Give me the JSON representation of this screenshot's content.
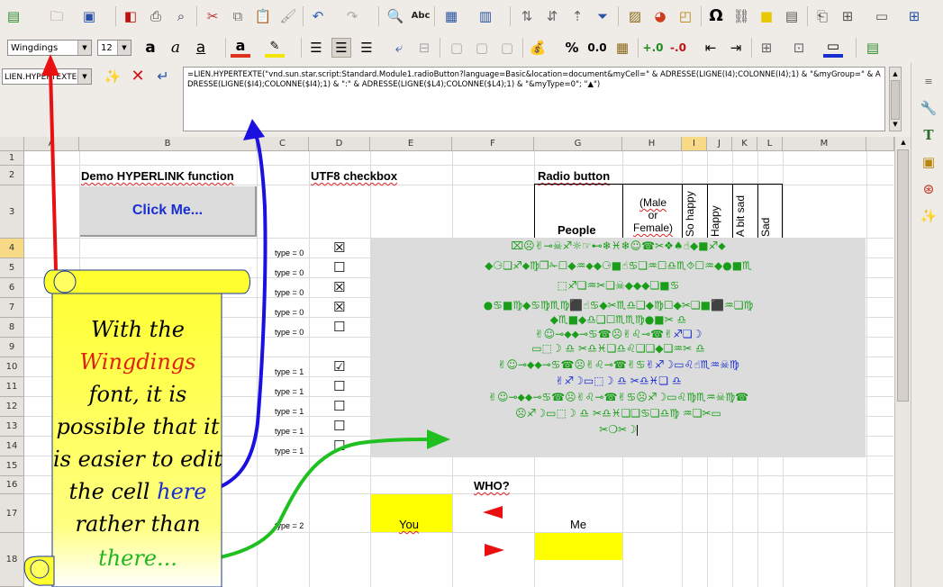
{
  "toolbar1": {
    "icons": [
      "new-document-icon",
      "open-icon",
      "save-icon",
      "pdf-export-icon",
      "print-icon",
      "print-preview-icon",
      "cut-icon",
      "copy-icon",
      "paste-icon",
      "clone-format-icon",
      "undo-icon",
      "redo-icon",
      "find-icon",
      "spellcheck-icon",
      "table-rows-icon",
      "table-columns-icon",
      "sort-ascending-icon",
      "sort-descending-icon",
      "sort-icon",
      "autofilter-icon",
      "image-icon",
      "chart-icon",
      "pivot-icon",
      "special-character-icon",
      "hyperlink-icon",
      "note-icon",
      "header-footer-icon",
      "define-print-area-icon",
      "freeze-icon",
      "split-window-icon",
      "show-draw-icon"
    ]
  },
  "toolbar2": {
    "font_name": "Wingdings",
    "font_size": "12",
    "number_format_percent": "%",
    "number_format_decimal": "0.0",
    "font_color": "#e03020",
    "highlight_color": "#f3e600"
  },
  "formula_bar": {
    "name_box": "LIEN.HYPERTEXTE",
    "formula": "=LIEN.HYPERTEXTE(\"vnd.sun.star.script:Standard.Module1.radioButton?language=Basic&location=document&myCell=\" & ADRESSE(LIGNE(I4);COLONNE(I4);1) & \"&myGroup=\" & ADRESSE(LIGNE($I4);COLONNE($I4);1) & \":\" & ADRESSE(LIGNE($L4);COLONNE($L4);1) & \"&myType=0\"; \"▲\")"
  },
  "columns": [
    "A",
    "B",
    "C",
    "D",
    "E",
    "F",
    "G",
    "H",
    "I",
    "J",
    "K",
    "L",
    "M"
  ],
  "rows": [
    "1",
    "2",
    "3",
    "4",
    "5",
    "6",
    "7",
    "8",
    "9",
    "10",
    "11",
    "12",
    "13",
    "14",
    "15",
    "16",
    "17",
    "18"
  ],
  "cells": {
    "b2": "Demo HYPERLINK function",
    "click_me": "Click Me...",
    "d2": "UTF8 checkbox",
    "g2": "Radio button",
    "g3": "People",
    "h3_line1": "(Male",
    "h3_line2": "or",
    "h3_line3": "Female)",
    "i3": "So happy",
    "j3": "Happy",
    "k3": "A bit sad",
    "l3": "Sad",
    "f16": "WHO?",
    "e17": "You",
    "g17": "Me"
  },
  "type_labels": [
    "type = 0",
    "type = 0",
    "type = 0",
    "type = 0",
    "type = 0",
    "type = 1",
    "type = 1",
    "type = 1",
    "type = 1",
    "type = 1",
    "type = 2"
  ],
  "checkboxes": [
    "☒",
    "☐",
    "☒",
    "☒",
    "☐",
    "☑",
    "☐",
    "☐",
    "☐",
    "☐"
  ],
  "wingdings_text": [
    {
      "t": "⌧☹✌⊸☠♐☼☞⊷❄♓❄☺☎✂❖♠☝◆■♐⬥",
      "c": "g"
    },
    {
      "t": "◆⚆❏♐⬥♍❐✁☐◆♒⬥◆⚆■☝♋❏♒☐♎♏⯑☐♒◆●■♏",
      "c": "g"
    },
    {
      "t": "⬚♐❏♒✂❏☠◆◆◆❏■♋",
      "c": "g"
    },
    {
      "t": "●♋■♍◆♋♍♏♍⬛☝♋◆✂♏♎❑◆♍☐◆✂❏■⬛♒❏♍",
      "c": "g"
    },
    {
      "t": "◆♏■◆♎❑☐♏♏♍●■✂ ♎",
      "c": "g"
    },
    {
      "t": "✌☺⊸⬥⬥⊸♋☎☹✌♌⊸☎✌",
      "c": "g",
      "t2": "♐❏☽",
      "c2": "b"
    },
    {
      "t": "▭⬚☽   ♎   ✂♎♓❏♎♌❏❏◆❏♒✂   ♎",
      "c": "g"
    },
    {
      "t": "✌☺⊸⬥⬥⊸♋☎☹✌♌⊸☎✌♋",
      "c": "g",
      "t2": "✌♐☽▭♌☝♏♒☠♍",
      "c2": "b"
    },
    {
      "t": "✌♐☽▭⬚☽   ♎   ✂♎♓❏   ♎",
      "c": "b"
    },
    {
      "t": "✌☺⊸⬥⬥⊸♋☎☹✌♌⊸☎✌♋☹♐☽▭♌♍♏♒☠♍☎",
      "c": "g"
    },
    {
      "t": "☹♐☽▭⬚☽   ♎   ✂♎♓❏❑♋❏♎♍ ♒❏✂▭",
      "c": "g"
    },
    {
      "t": "✂❍✂☽",
      "c": "g"
    }
  ],
  "note": {
    "line1": "With the",
    "line2": "Wingdings",
    "line3": "font, it is",
    "line4": "possible that it",
    "line5": "is easier to edit",
    "line6_a": "the cell",
    "line6_b": "here",
    "line7": "rather than",
    "line8": "there...",
    "accent_red": "#e02010",
    "accent_blue": "#1a2fd0",
    "accent_green": "#20b820",
    "scroll_color": "#ffff30"
  }
}
